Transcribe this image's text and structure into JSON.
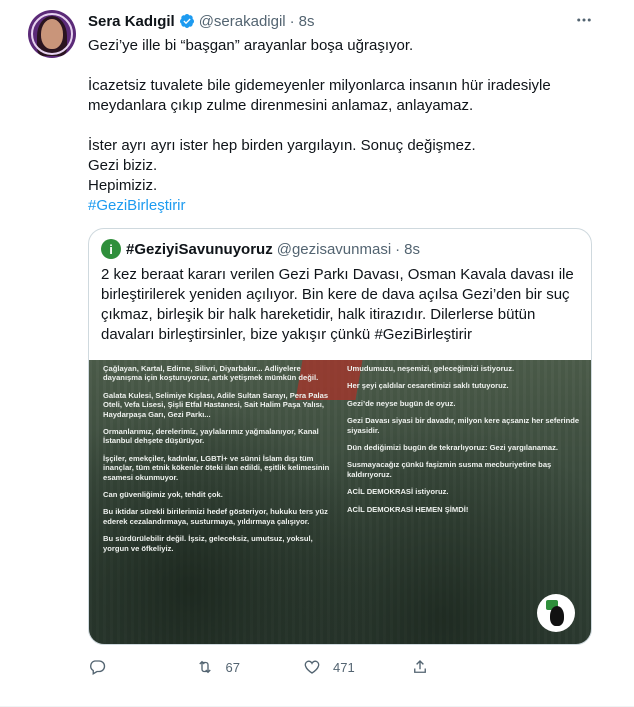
{
  "tweet": {
    "name": "Sera Kadıgil",
    "handle": "@serakadigil",
    "separator": "·",
    "time": "8s",
    "lines": [
      "Gezi’ye ille bi “başgan” arayanlar boşa uğraşıyor.",
      "",
      "İcazetsiz tuvalete bile gidemeyenler milyonlarca insanın hür iradesiyle meydanlara çıkıp zulme direnmesini anlamaz, anlayamaz.",
      "",
      "İster ayrı ayrı ister hep birden yargılayın. Sonuç değişmez.",
      "Gezi biziz.",
      "Hepimiziz."
    ],
    "hashtag": "#GeziBirleştirir",
    "more_icon": "more-horizontal-icon"
  },
  "quote": {
    "name": "#GeziyiSavunuyoruz",
    "handle": "@gezisavunmasi",
    "separator": "·",
    "time": "8s",
    "text": "2 kez beraat kararı verilen Gezi Parkı Davası, Osman Kavala davası ile birleştirilerek yeniden açılıyor. Bin kere de dava açılsa Gezi’den bir suç çıkmaz, birleşik bir halk hareketidir, halk itirazıdır. Dilerlerse bütün davaları birleştirsinler, bize yakışır çünkü #GeziBirleştirir",
    "image_left": [
      "Çağlayan, Kartal, Edirne, Silivri, Diyarbakır... Adliyelere dayanışma için koşturuyoruz, artık yetişmek mümkün değil.",
      "Galata Kulesi, Selimiye Kışlası, Adile Sultan Sarayı, Pera Palas Oteli, Vefa Lisesi, Şişli Etfal Hastanesi, Sait Halim Paşa Yalısı, Haydarpaşa Garı, Gezi Parkı...",
      "Ormanlarımız, derelerimiz, yaylalarımız yağmalanıyor, Kanal İstanbul dehşete düşürüyor.",
      "İşçiler, emekçiler, kadınlar, LGBTİ+ ve sünni İslam dışı tüm inançlar, tüm etnik kökenler öteki ilan edildi, eşitlik kelimesinin esamesi okunmuyor.",
      "Can güvenliğimiz yok, tehdit çok.",
      "Bu iktidar sürekli birilerimizi hedef gösteriyor, hukuku ters yüz ederek cezalandırmaya, susturmaya, yıldırmaya çalışıyor.",
      "Bu sürdürülebilir değil. İşsiz, geleceksiz, umutsuz, yoksul, yorgun ve öfkeliyiz."
    ],
    "image_right": [
      "Umudumuzu, neşemizi, geleceğimizi istiyoruz.",
      "Her şeyi çaldılar cesaretimizi saklı tutuyoruz.",
      "Gezi’de neyse bugün de oyuz.",
      "Gezi Davası siyasi bir davadır, milyon kere açsanız her seferinde siyasidir.",
      "Dün dediğimizi bugün de tekrarlıyoruz: Gezi yargılanamaz.",
      "Susmayacağız çünkü faşizmin susma mecburiyetine baş kaldırıyoruz.",
      "ACİL DEMOKRASİ istiyoruz.",
      "ACİL DEMOKRASİ HEMEN ŞİMDİ!"
    ]
  },
  "actions": {
    "reply_icon": "reply-icon",
    "retweet_icon": "retweet-icon",
    "retweet_count": "67",
    "like_icon": "heart-icon",
    "like_count": "471",
    "share_icon": "share-icon"
  },
  "colors": {
    "link": "#1d9bf0",
    "muted": "#536471",
    "border": "#cfd9de",
    "verified": "#1d9bf0"
  }
}
